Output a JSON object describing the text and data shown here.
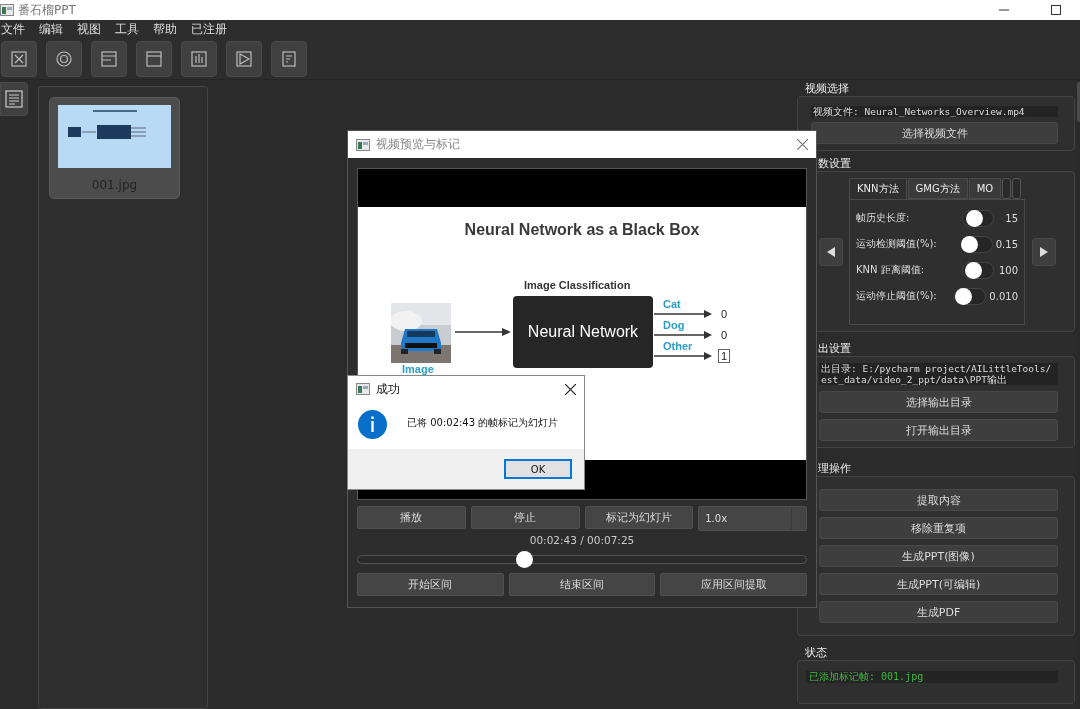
{
  "window": {
    "title": "番石榴PPT"
  },
  "menu": [
    {
      "label": "文件"
    },
    {
      "label": "编辑"
    },
    {
      "label": "视图"
    },
    {
      "label": "工具"
    },
    {
      "label": "帮助"
    },
    {
      "label": "已注册"
    }
  ],
  "thumbnails": [
    {
      "label": "001.jpg"
    }
  ],
  "video_panel": {
    "title": "视频选择",
    "file_label": "视频文件: Neural_Networks_Overview.mp4",
    "button": "选择视频文件"
  },
  "params_panel": {
    "title": "数设置",
    "tabs": [
      {
        "label": "KNN方法",
        "selected": true
      },
      {
        "label": "GMG方法",
        "selected": false
      },
      {
        "label": "MO",
        "selected": false
      }
    ],
    "sliders": [
      {
        "label": "帧历史长度:",
        "level": 0.25,
        "reading": "15"
      },
      {
        "label": "运动检测阈值(%):",
        "level": 0.05,
        "reading": "0.15"
      },
      {
        "label": "KNN 距离阈值:",
        "level": 0.2,
        "reading": "100"
      },
      {
        "label": "运动停止阈值(%):",
        "level": 0.05,
        "reading": "0.010"
      }
    ]
  },
  "output_panel": {
    "title": "出设置",
    "path_lines": [
      "出目录: E:/pycharm project/AILittleTools/",
      "est_data/video_2_ppt/data\\PPT输出"
    ],
    "buttons": [
      "选择输出目录",
      "打开输出目录"
    ]
  },
  "process_panel": {
    "title": "理操作",
    "buttons": [
      "提取内容",
      "移除重复项",
      "生成PPT(图像)",
      "生成PPT(可编辑)",
      "生成PDF"
    ]
  },
  "status_panel": {
    "title": "状态",
    "message": "已添加标记帧: 001.jpg"
  },
  "preview_dialog": {
    "title": "视频预览与标记",
    "slide": {
      "title": "Neural Network as a Black Box",
      "subtitle": "Image Classification",
      "box": "Neural Network",
      "image_label": "Image",
      "outputs": [
        {
          "label": "Cat",
          "value": "0",
          "boxed": false
        },
        {
          "label": "Dog",
          "value": "0",
          "boxed": false
        },
        {
          "label": "Other",
          "value": "1",
          "boxed": true
        }
      ]
    },
    "buttons": [
      "播放",
      "停止",
      "标记为幻灯片"
    ],
    "speed": "1.0x",
    "time": "00:02:43 / 00:07:25",
    "seek": {
      "level": 0.37
    },
    "range_buttons": [
      "开始区间",
      "结束区间",
      "应用区间提取"
    ]
  },
  "message_box": {
    "title": "成功",
    "text": "已将 00:02:43 的帧标记为幻灯片",
    "button": "OK"
  }
}
